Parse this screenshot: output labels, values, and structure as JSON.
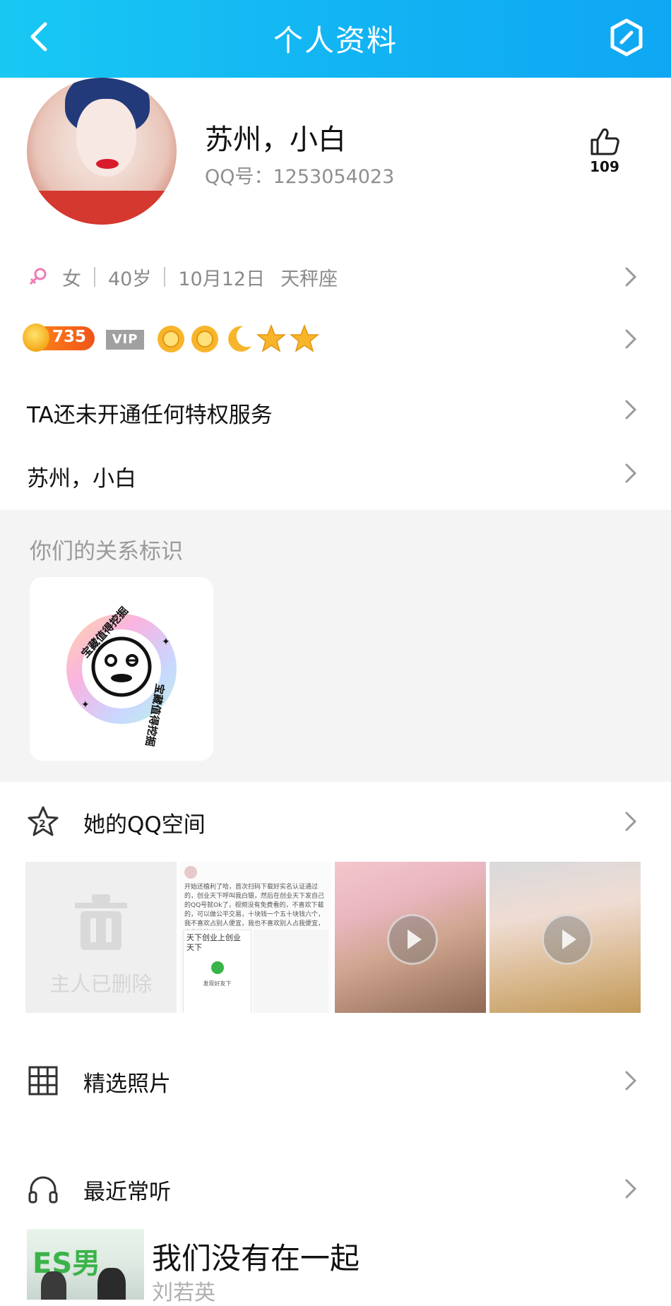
{
  "header": {
    "title": "个人资料",
    "bg_colors": [
      "#18c8f3",
      "#0fa7f3"
    ]
  },
  "profile": {
    "name": "苏州，小白",
    "qq_label": "QQ号：1253054023",
    "likes": "109"
  },
  "info": {
    "gender": "女",
    "age": "40岁",
    "birthday": "10月12日",
    "zodiac": "天秤座"
  },
  "level": {
    "value": "735",
    "vip": "VIP",
    "icons": [
      "sun-icon",
      "sun-icon",
      "moon-icon",
      "star-icon",
      "star-icon"
    ]
  },
  "rows": {
    "privilege": "TA还未开通任何特权服务",
    "signature": "苏州，小白"
  },
  "relation": {
    "title": "你们的关系标识",
    "badge_text": "宝藏值得挖掘"
  },
  "qzone": {
    "label": "她的QQ空间",
    "deleted_text": "主人已删除",
    "post_text": "开始还植利了哈，首次扫码下载好实名认证通过的，创业天下呼叫我白银，然后在创业天下发自己的QQ号就Ok了，视频没有免费看的，不喜欢下载的，可以做公平交易，十块钱一个五十块钱六个，我不喜欢占别人便宜，我也不喜欢别人占我便宜，合作愉快",
    "post_card_title": "天下创业上创业天下",
    "post_card_action": "发现好友下"
  },
  "photos": {
    "label": "精选照片"
  },
  "music": {
    "label": "最近常听",
    "song_title": "我们没有在一起",
    "artist": "刘若英",
    "cover_logo": "ES男"
  }
}
